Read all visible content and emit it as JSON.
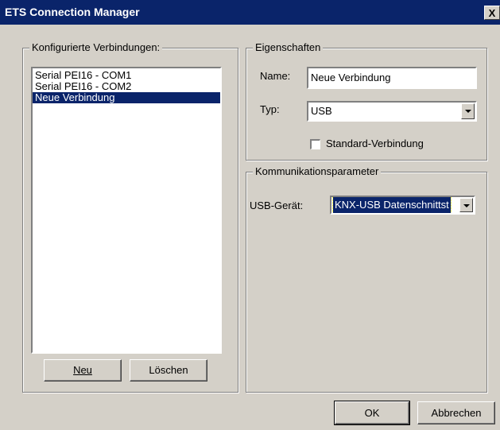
{
  "window": {
    "title": "ETS Connection Manager",
    "close_glyph": "X"
  },
  "connections": {
    "legend": "Konfigurierte Verbindungen:",
    "items": [
      {
        "label": "Serial PEI16 - COM1"
      },
      {
        "label": "Serial PEI16 - COM2"
      },
      {
        "label": "Neue Verbindung",
        "selected": true
      }
    ],
    "new_button": "Neu",
    "delete_button": "Löschen"
  },
  "properties": {
    "legend": "Eigenschaften",
    "name_label": "Name:",
    "name_value": "Neue Verbindung",
    "type_label": "Typ:",
    "type_value": "USB",
    "standard_checkbox_label": "Standard-Verbindung",
    "standard_checked": false
  },
  "communication": {
    "legend": "Kommunikationsparameter",
    "usb_device_label": "USB-Gerät:",
    "usb_device_value": "KNX-USB Datenschnittst"
  },
  "footer": {
    "ok_button": "OK",
    "cancel_button": "Abbrechen"
  }
}
